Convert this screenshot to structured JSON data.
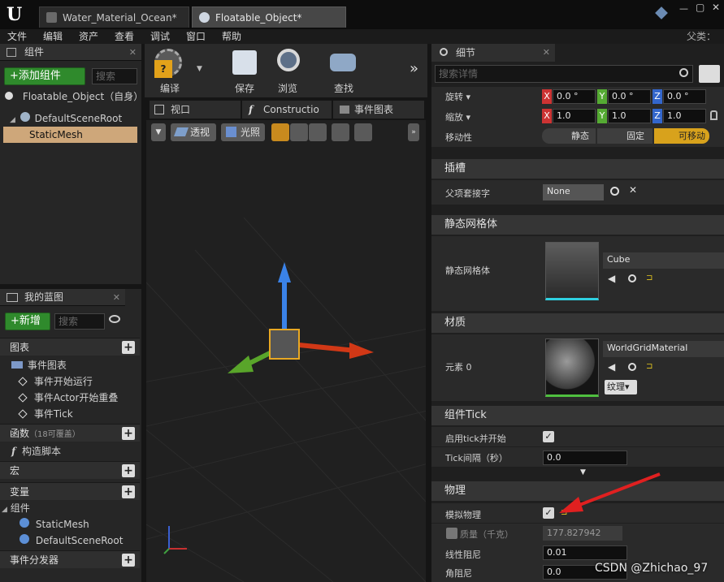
{
  "titlebar": {
    "tabs": [
      "Water_Material_Ocean*",
      "Floatable_Object*"
    ]
  },
  "menubar": {
    "items": [
      "文件",
      "编辑",
      "资产",
      "查看",
      "调试",
      "窗口",
      "帮助"
    ],
    "parent_label": "父类："
  },
  "components_panel": {
    "title": "组件",
    "add_button": "+添加组件",
    "search_placeholder": "搜索",
    "self_label": "Floatable_Object（自身）",
    "tree": [
      "DefaultSceneRoot",
      "StaticMesh"
    ]
  },
  "toolbar": {
    "compile": "编译",
    "save": "保存",
    "browse": "浏览",
    "find": "查找"
  },
  "viewport": {
    "tabs": [
      "视口",
      "Constructio",
      "事件图表"
    ],
    "perspective": "透视",
    "lit": "光照"
  },
  "my_blueprint": {
    "title": "我的蓝图",
    "new_button": "+新增",
    "search_placeholder": "搜索",
    "graphs_header": "图表",
    "event_graph": "事件图表",
    "events": [
      "事件开始运行",
      "事件Actor开始重叠",
      "事件Tick"
    ],
    "functions_header": "函数",
    "functions_note": "（18可覆盖）",
    "construct_script": "构造脚本",
    "macros_header": "宏",
    "variables_header": "变量",
    "components_header": "组件",
    "component_items": [
      "StaticMesh",
      "DefaultSceneRoot"
    ],
    "dispatchers_header": "事件分发器"
  },
  "details": {
    "title": "细节",
    "search_placeholder": "搜索详情",
    "rotation_label": "旋转",
    "rotation": [
      "0.0 °",
      "0.0 °",
      "0.0 °"
    ],
    "scale_label": "缩放",
    "scale": [
      "1.0",
      "1.0",
      "1.0"
    ],
    "mobility_label": "移动性",
    "mobility": [
      "静态",
      "固定",
      "可移动"
    ],
    "socket_section": "插槽",
    "parent_socket_label": "父项套接字",
    "parent_socket_value": "None",
    "static_mesh_section": "静态网格体",
    "static_mesh_label": "静态网格体",
    "mesh_name": "Cube",
    "material_section": "材质",
    "element_label": "元素 0",
    "material_name": "WorldGridMaterial",
    "texture_button": "纹理",
    "tick_section": "组件Tick",
    "tick_enable_label": "启用tick并开始",
    "tick_interval_label": "Tick间隔（秒）",
    "tick_interval_value": "0.0",
    "physics_section": "物理",
    "simulate_label": "模拟物理",
    "mass_label": "质量（千克）",
    "mass_value": "177.827942",
    "linear_damping_label": "线性阻尼",
    "linear_damping_value": "0.01",
    "angular_damping_label": "角阻尼",
    "angular_damping_value": "0.0"
  },
  "watermark": "CSDN @Zhichao_97",
  "colors": {
    "accent_green": "#2f8a2c",
    "selection": "#cea77a",
    "movable": "#d8a21c",
    "annotation_arrow": "#e02020"
  }
}
